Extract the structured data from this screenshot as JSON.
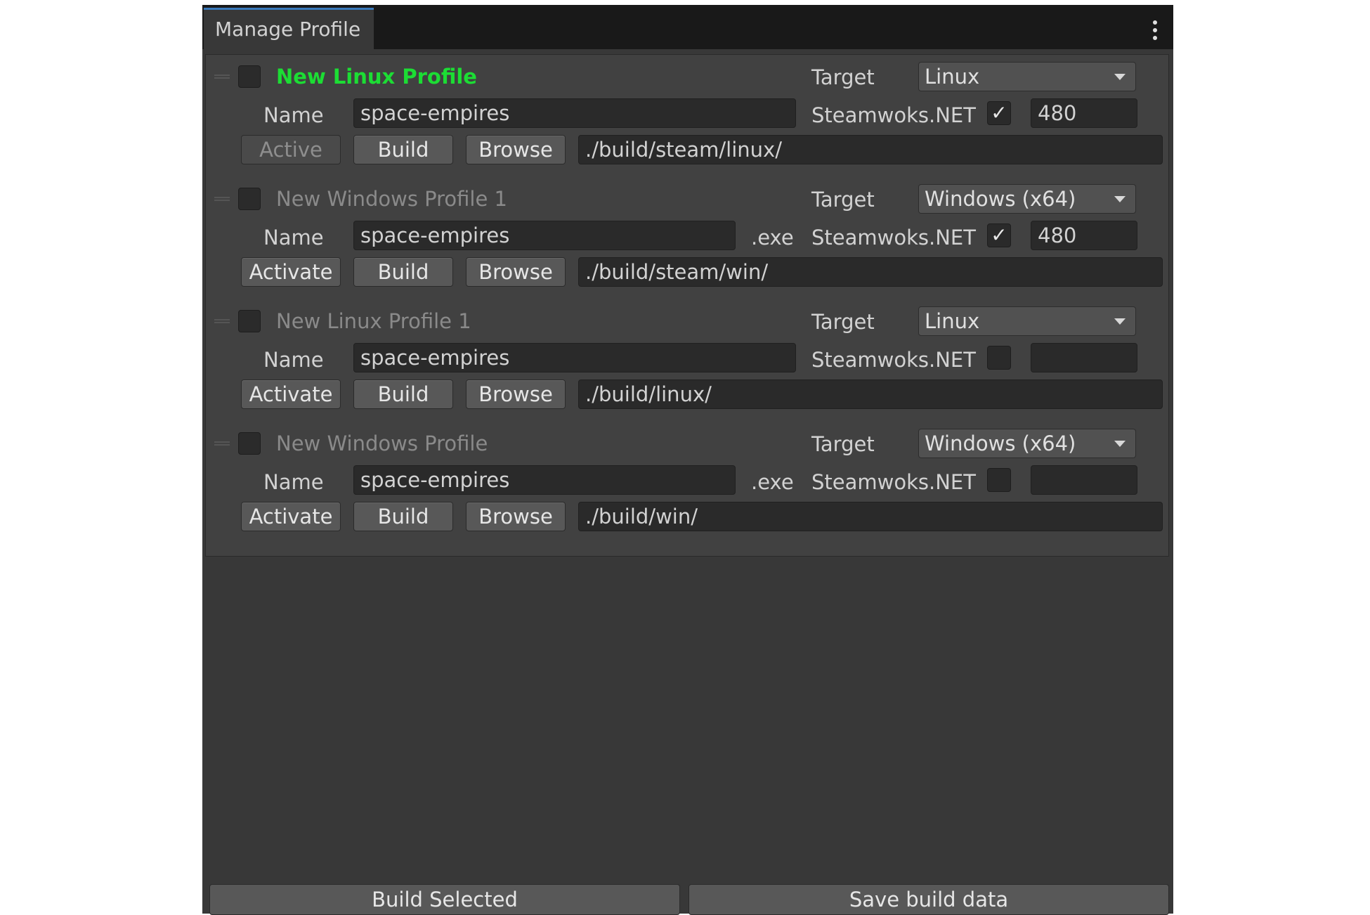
{
  "window": {
    "tab_title": "Manage Profile",
    "menu_icon": "kebab-menu-icon"
  },
  "labels": {
    "target": "Target",
    "name": "Name",
    "steamworks": "Steamwoks.NET",
    "ext": ".exe"
  },
  "buttons": {
    "active": "Active",
    "activate": "Activate",
    "build": "Build",
    "browse": "Browse"
  },
  "profiles": [
    {
      "title": "New Linux Profile",
      "is_active": true,
      "selected": false,
      "target": "Linux",
      "name": "space-empires",
      "ext": "",
      "steamworks": true,
      "app_id": "480",
      "path": "./build/steam/linux/"
    },
    {
      "title": "New Windows Profile 1",
      "is_active": false,
      "selected": false,
      "target": "Windows (x64)",
      "name": "space-empires",
      "ext": ".exe",
      "steamworks": true,
      "app_id": "480",
      "path": "./build/steam/win/"
    },
    {
      "title": "New Linux Profile 1",
      "is_active": false,
      "selected": false,
      "target": "Linux",
      "name": "space-empires",
      "ext": "",
      "steamworks": false,
      "app_id": "",
      "path": "./build/linux/"
    },
    {
      "title": "New Windows Profile",
      "is_active": false,
      "selected": false,
      "target": "Windows (x64)",
      "name": "space-empires",
      "ext": ".exe",
      "steamworks": false,
      "app_id": "",
      "path": "./build/win/"
    }
  ],
  "footer": {
    "build_selected": "Build Selected",
    "save_build_data": "Save build data"
  },
  "colors": {
    "active_profile": "#1cdd34",
    "background": "#383838",
    "field": "#2a2a2a"
  }
}
